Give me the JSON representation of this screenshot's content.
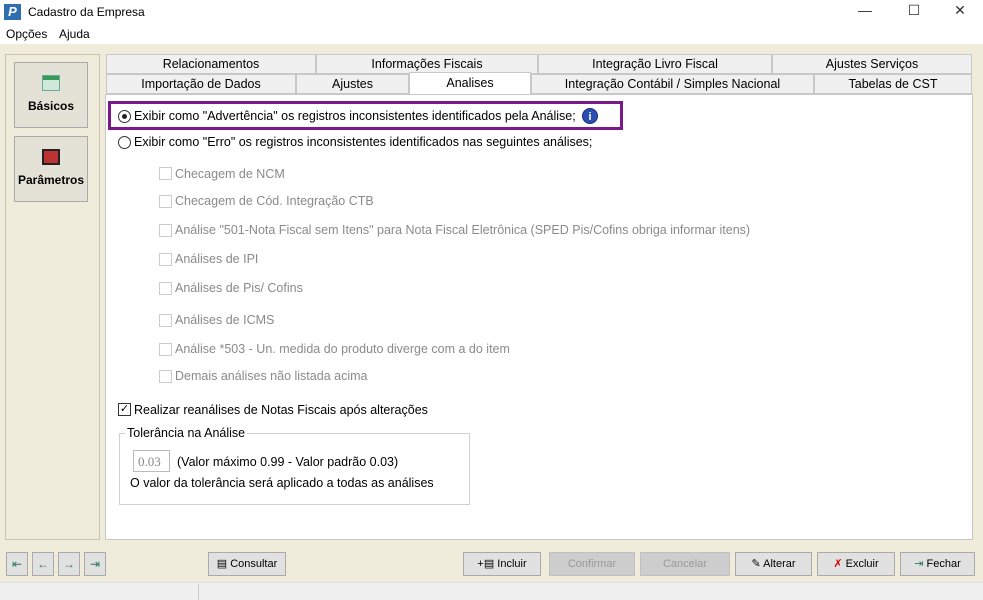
{
  "window": {
    "title": "Cadastro da Empresa",
    "icon_letter": "P",
    "minimize": "—",
    "maximize": "☐",
    "close": "✕"
  },
  "menu": [
    "Opções",
    "Ajuda"
  ],
  "sidebar": [
    {
      "label": "Básicos"
    },
    {
      "label": "Parâmetros"
    }
  ],
  "tabs_row1": [
    "Relacionamentos",
    "Informações Fiscais",
    "Integração Livro Fiscal",
    "Ajustes Serviços"
  ],
  "tabs_row2": [
    "Importação de Dados",
    "Ajustes",
    "Analises",
    "Integração Contábil / Simples Nacional",
    "Tabelas de CST"
  ],
  "active_tab": "Analises",
  "options": {
    "radio_warning": "Exibir como \"Advertência\" os registros inconsistentes identificados pela Análise;",
    "radio_error": "Exibir como \"Erro\" os registros inconsistentes identificados nas seguintes análises;",
    "selected": "warning",
    "checks": [
      "Checagem de NCM",
      "Checagem de Cód. Integração CTB",
      "Análise \"501-Nota Fiscal sem Itens\" para Nota Fiscal Eletrônica (SPED Pis/Cofins obriga informar itens)",
      "Análises de IPI",
      "Análises de Pis/ Cofins",
      "Análises de ICMS",
      "Análise *503 - Un. medida do produto diverge com a do item",
      "Demais análises não listada acima"
    ],
    "reanalysis": "Realizar reanálises de Notas Fiscais após alterações",
    "reanalysis_checked": true
  },
  "tolerance": {
    "group": "Tolerância na Análise",
    "value": "0.03",
    "hint": "(Valor máximo 0.99 - Valor padrão 0.03)",
    "note": "O valor da tolerância será aplicado a todas as análises"
  },
  "buttons": {
    "consultar": "Consultar",
    "incluir": "Incluir",
    "confirmar": "Confirmar",
    "cancelar": "Cancelar",
    "alterar": "Alterar",
    "excluir": "Excluir",
    "fechar": "Fechar"
  }
}
